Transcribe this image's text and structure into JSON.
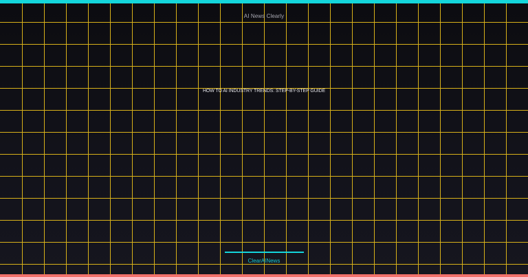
{
  "brand": {
    "top_label": "AI News Clearly",
    "bottom_label": "ClearAINews"
  },
  "headline": {
    "text": "HOW TO AI INDUSTRY TRENDS: STEP-BY-STEP GUIDE"
  },
  "colors": {
    "top_bar": "#14d6dc",
    "bottom_bar": "#f1706a",
    "grid": "#d9b21a",
    "accent_line": "#14d6dc",
    "background": "#0f0f14"
  }
}
